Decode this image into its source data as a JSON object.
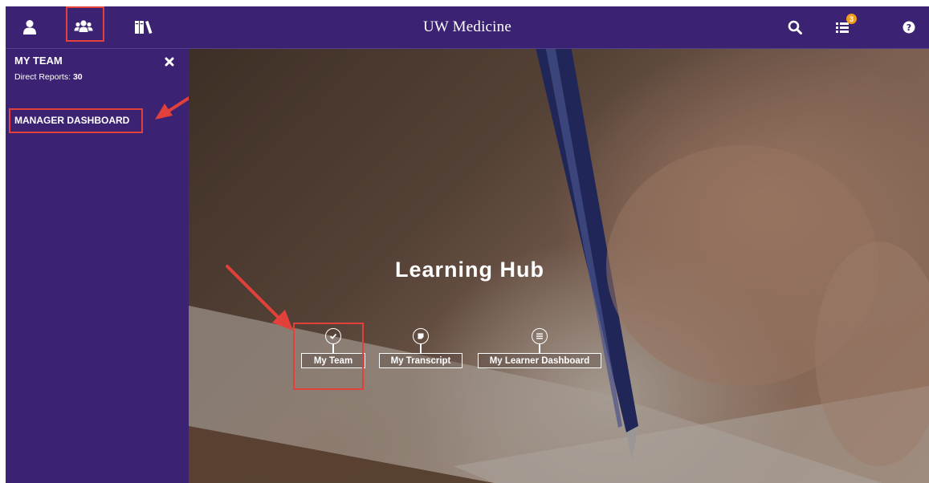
{
  "header": {
    "brand": "UW Medicine",
    "notification_count": "3"
  },
  "sidebar": {
    "title": "MY TEAM",
    "direct_reports_label": "Direct Reports:",
    "direct_reports_count": "30",
    "link": "MANAGER DASHBOARD"
  },
  "hero": {
    "title": "Learning Hub",
    "tiles": [
      {
        "label": "My Team",
        "icon": "check-circle-icon"
      },
      {
        "label": "My Transcript",
        "icon": "note-icon"
      },
      {
        "label": "My Learner Dashboard",
        "icon": "list-icon"
      }
    ]
  },
  "colors": {
    "brand_purple": "#3b2273",
    "annotation_red": "#e2403a",
    "badge_orange": "#f39c1e"
  }
}
